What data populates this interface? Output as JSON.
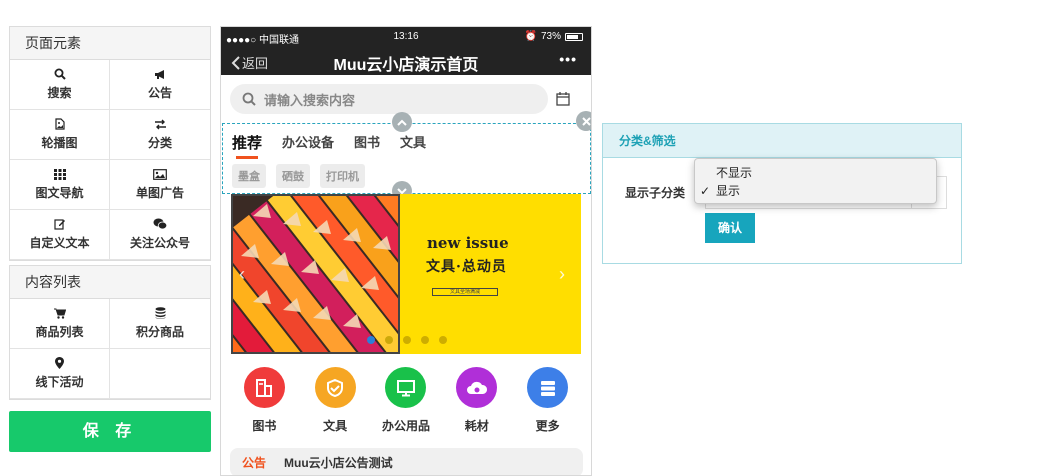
{
  "sidebar": {
    "page_elements": {
      "title": "页面元素",
      "items": [
        {
          "label": "搜索",
          "icon": "search-icon"
        },
        {
          "label": "公告",
          "icon": "megaphone-icon"
        },
        {
          "label": "轮播图",
          "icon": "file-image-icon"
        },
        {
          "label": "分类",
          "icon": "exchange-icon"
        },
        {
          "label": "图文导航",
          "icon": "grid-icon"
        },
        {
          "label": "单图广告",
          "icon": "picture-icon"
        },
        {
          "label": "自定义文本",
          "icon": "edit-icon"
        },
        {
          "label": "关注公众号",
          "icon": "wechat-icon"
        }
      ]
    },
    "content_list": {
      "title": "内容列表",
      "items": [
        {
          "label": "商品列表",
          "icon": "cart-icon"
        },
        {
          "label": "积分商品",
          "icon": "database-icon"
        },
        {
          "label": "线下活动",
          "icon": "map-marker-icon"
        }
      ]
    },
    "save_label": "保 存"
  },
  "phone": {
    "status": {
      "carrier": "●●●●○ 中国联通",
      "time": "13:16",
      "battery": "73%"
    },
    "nav": {
      "back": "返回",
      "title": "Muu云小店演示首页",
      "more": "•••"
    },
    "search_placeholder": "请输入搜索内容",
    "tabs": [
      "推荐",
      "办公设备",
      "图书",
      "文具"
    ],
    "chips": [
      "墨盒",
      "硒鼓",
      "打印机"
    ],
    "banner": {
      "headline": "new issue",
      "subtitle": "文具·总动员",
      "small_text": "文具全场满减",
      "slide_count": 5,
      "active_slide": 0
    },
    "quick_links": [
      {
        "label": "图书",
        "color": "#f03b3b"
      },
      {
        "label": "文具",
        "color": "#f6a623"
      },
      {
        "label": "办公用品",
        "color": "#19c14a"
      },
      {
        "label": "耗材",
        "color": "#b02fd8"
      },
      {
        "label": "更多",
        "color": "#3d7fe8"
      }
    ],
    "notice": {
      "tag": "公告",
      "text": "Muu云小店公告测试"
    }
  },
  "settings": {
    "header": "分类&筛选",
    "field_label": "显示子分类",
    "options": [
      "不显示",
      "显示"
    ],
    "selected": "显示",
    "confirm_label": "确认"
  }
}
